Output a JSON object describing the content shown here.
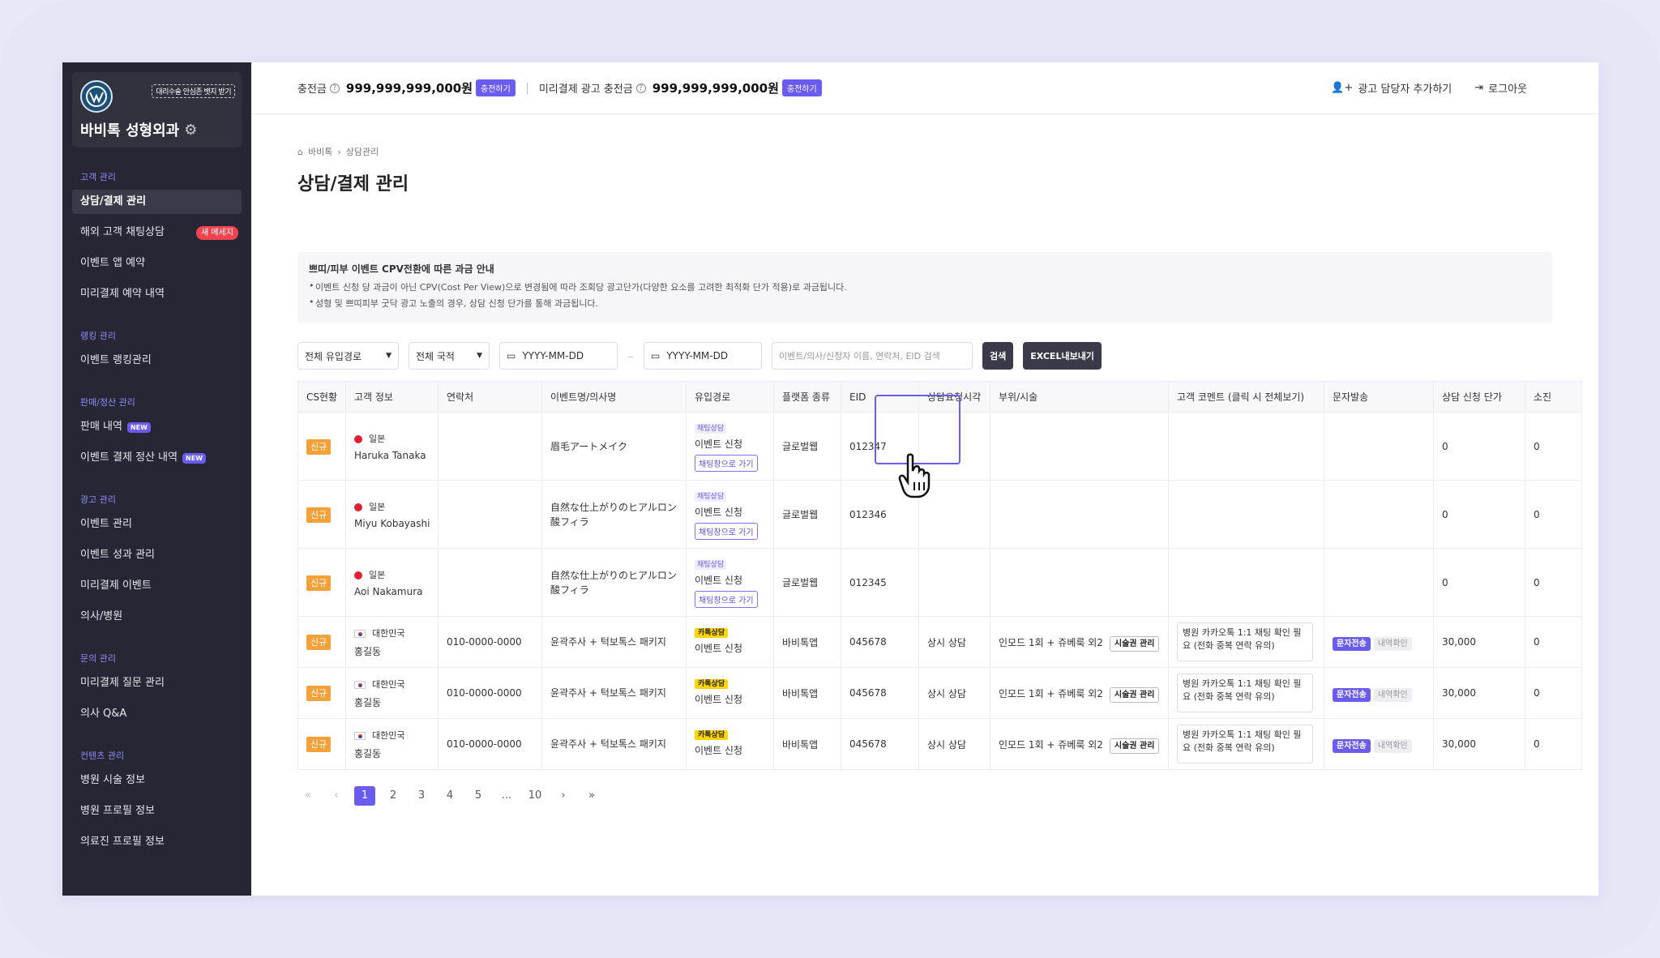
{
  "sidebar": {
    "badge": "대리수술 안심존 뱃지 받기",
    "clinic_name": "바비톡 성형외과",
    "sections": [
      {
        "title": "고객 관리",
        "items": [
          {
            "label": "상담/결제 관리"
          },
          {
            "label": "해외 고객 채팅상담",
            "badge": "새 메세지"
          },
          {
            "label": "이벤트 앱 예약"
          },
          {
            "label": "미리결제 예약 내역"
          }
        ]
      },
      {
        "title": "랭킹 관리",
        "items": [
          {
            "label": "이벤트 랭킹관리"
          }
        ]
      },
      {
        "title": "판매/정산 관리",
        "items": [
          {
            "label": "판매 내역",
            "badge": "NEW"
          },
          {
            "label": "이벤트 결제 정산 내역",
            "badge": "NEW"
          }
        ]
      },
      {
        "title": "광고 관리",
        "items": [
          {
            "label": "이벤트 관리"
          },
          {
            "label": "이벤트 성과 관리"
          },
          {
            "label": "미리결제 이벤트"
          },
          {
            "label": "의사/병원"
          }
        ]
      },
      {
        "title": "문의 관리",
        "items": [
          {
            "label": "미리결제 질문 관리"
          },
          {
            "label": "의사 Q&A"
          }
        ]
      },
      {
        "title": "컨텐츠 관리",
        "items": [
          {
            "label": "병원 시술 정보"
          },
          {
            "label": "병원 프로필 정보"
          },
          {
            "label": "의료진 프로필 정보"
          }
        ]
      }
    ]
  },
  "topbar": {
    "charge_label": "충전금",
    "charge_amount": "999,999,999,000원",
    "charge_btn": "충전하기",
    "prepay_label": "미리결제 광고 충전금",
    "prepay_amount": "999,999,999,000원",
    "prepay_btn": "충전하기",
    "add_manager": "광고 담당자 추가하기",
    "logout": "로그아웃"
  },
  "breadcrumb": {
    "home": "바비톡",
    "current": "상담관리"
  },
  "page_title": "상담/결제 관리",
  "notice": {
    "title": "쁘띠/피부 이벤트 CPV전환에 따른 과금 안내",
    "lines": [
      "이벤트 신청 당 과금이 아닌 CPV(Cost Per View)으로 변경됨에 따라 조회당 광고단가(다양한 요소를 고려한 최적화 단가 적용)로 과금됩니다.",
      "성형 및 쁘띠피부 굿닥 광고 노출의 경우, 상담 신청 단가를 통해 과금됩니다."
    ]
  },
  "filters": {
    "channel": "전체 유입경로",
    "country": "전체 국적",
    "date_from": "YYYY-MM-DD",
    "date_to": "YYYY-MM-DD",
    "search_placeholder": "이벤트/의사/신청자 이름, 연락처, EID 검색",
    "search_btn": "검색",
    "excel_btn": "EXCEL내보내기"
  },
  "table": {
    "headers": [
      "CS현황",
      "고객 정보",
      "연락처",
      "이벤트명/의사명",
      "유입경로",
      "플랫폼 종류",
      "EID",
      "상담요청시각",
      "부위/시술",
      "고객 코멘트 (클릭 시 전체보기)",
      "문자발송",
      "상담 신청 단가",
      "소진"
    ],
    "rows": [
      {
        "status": "신규",
        "country": "일본",
        "name": "Haruka Tanaka",
        "phone": "",
        "event": "眉毛アートメイク",
        "src_tag": "채팅상담",
        "src": "이벤트 신청",
        "src_btn": "채팅창으로 가기",
        "platform": "글로벌웹",
        "eid": "012347",
        "time": "",
        "part": "",
        "comment": "",
        "price": "0",
        "used": "0"
      },
      {
        "status": "신규",
        "country": "일본",
        "name": "Miyu Kobayashi",
        "phone": "",
        "event": "自然な仕上がりのヒアルロン酸フィラ",
        "src_tag": "채팅상담",
        "src": "이벤트 신청",
        "src_btn": "채팅창으로 가기",
        "platform": "글로벌웹",
        "eid": "012346",
        "time": "",
        "part": "",
        "comment": "",
        "price": "0",
        "used": "0"
      },
      {
        "status": "신규",
        "country": "일본",
        "name": "Aoi Nakamura",
        "phone": "",
        "event": "自然な仕上がりのヒアルロン酸フィラ",
        "src_tag": "채팅상담",
        "src": "이벤트 신청",
        "src_btn": "채팅창으로 가기",
        "platform": "글로벌웹",
        "eid": "012345",
        "time": "",
        "part": "",
        "comment": "",
        "price": "0",
        "used": "0"
      },
      {
        "status": "신규",
        "country": "대한민국",
        "name": "홍길동",
        "phone": "010-0000-0000",
        "event": "윤곽주사 + 턱보톡스 패키지",
        "src_tag": "카톡상담",
        "src": "이벤트 신청",
        "platform": "바비톡앱",
        "eid": "045678",
        "time": "상시 상담",
        "part": "인모드 1회 + 쥬베룩 외2",
        "part_btn": "시술권 관리",
        "comment": "병원 카카오톡 1:1 채팅 확인 필요 (전화 중복 연락 유의)",
        "sms_btn": "문자전송",
        "hist_btn": "내역확인",
        "price": "30,000",
        "used": "0"
      },
      {
        "status": "신규",
        "country": "대한민국",
        "name": "홍길동",
        "phone": "010-0000-0000",
        "event": "윤곽주사 + 턱보톡스 패키지",
        "src_tag": "카톡상담",
        "src": "이벤트 신청",
        "platform": "바비톡앱",
        "eid": "045678",
        "time": "상시 상담",
        "part": "인모드 1회 + 쥬베룩 외2",
        "part_btn": "시술권 관리",
        "comment": "병원 카카오톡 1:1 채팅 확인 필요 (전화 중복 연락 유의)",
        "sms_btn": "문자전송",
        "hist_btn": "내역확인",
        "price": "30,000",
        "used": "0"
      },
      {
        "status": "신규",
        "country": "대한민국",
        "name": "홍길동",
        "phone": "010-0000-0000",
        "event": "윤곽주사 + 턱보톡스 패키지",
        "src_tag": "카톡상담",
        "src": "이벤트 신청",
        "platform": "바비톡앱",
        "eid": "045678",
        "time": "상시 상담",
        "part": "인모드 1회 + 쥬베룩 외2",
        "part_btn": "시술권 관리",
        "comment": "병원 카카오톡 1:1 채팅 확인 필요 (전화 중복 연락 유의)",
        "sms_btn": "문자전송",
        "hist_btn": "내역확인",
        "price": "30,000",
        "used": "0"
      }
    ]
  },
  "pagination": {
    "pages": [
      "1",
      "2",
      "3",
      "4",
      "5",
      "...",
      "10"
    ],
    "current": "1"
  },
  "colors": {
    "accent": "#6a5cf0",
    "sidebar_bg": "#262634",
    "new_tag": "#f4a13a",
    "kakao": "#ffd600"
  }
}
